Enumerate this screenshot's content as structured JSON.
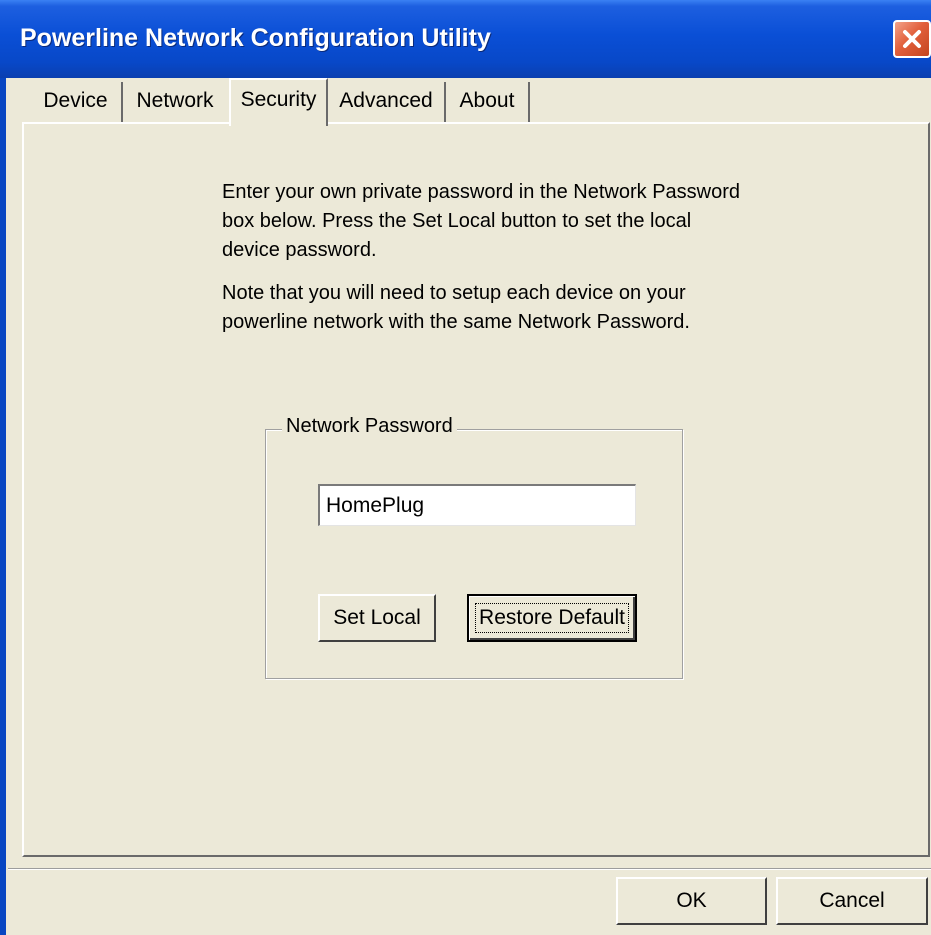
{
  "window": {
    "title": "Powerline Network Configuration Utility",
    "titlebar_color": "#0a4fd6",
    "close_icon": "close-icon"
  },
  "tabs": [
    {
      "label": "Device",
      "active": false
    },
    {
      "label": "Network",
      "active": false
    },
    {
      "label": "Security",
      "active": true
    },
    {
      "label": "Advanced",
      "active": false
    },
    {
      "label": "About",
      "active": false
    }
  ],
  "security": {
    "instructions": [
      "Enter your own private password in the Network Password box below. Press the Set Local button to set the local device password.",
      "Note that you will need to setup each device on your powerline network with the same Network Password."
    ],
    "group_label": "Network Password",
    "password_value": "HomePlug",
    "set_local_label": "Set Local",
    "restore_default_label": "Restore Default"
  },
  "footer": {
    "ok_label": "OK",
    "cancel_label": "Cancel"
  }
}
